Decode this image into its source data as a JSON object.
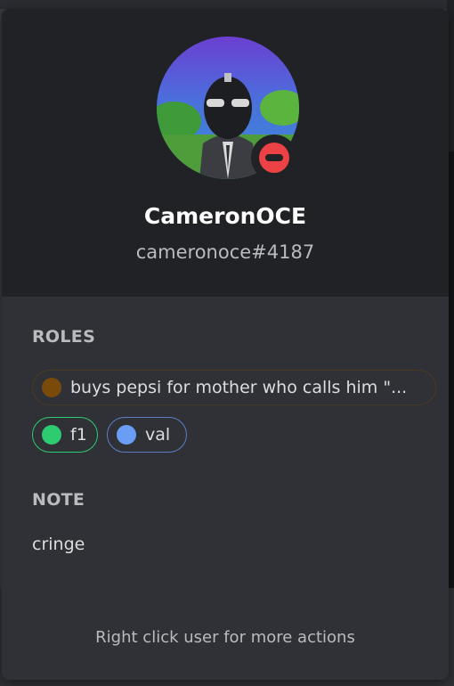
{
  "profile": {
    "display_name": "CameronOCE",
    "username": "cameronoce#4187",
    "status": "do-not-disturb",
    "status_color": "#ed4245"
  },
  "roles": {
    "title": "ROLES",
    "items": [
      {
        "label": "buys pepsi for mother who calls him \"...",
        "color": "#7a4a0b"
      },
      {
        "label": "f1",
        "color": "#2ecc71"
      },
      {
        "label": "val",
        "color": "#6a9ef5"
      }
    ]
  },
  "note": {
    "title": "NOTE",
    "value": "cringe"
  },
  "footer": {
    "hint": "Right click user for more actions"
  },
  "colors": {
    "popout_bg": "#2f3136",
    "header_bg": "#202225",
    "text_primary": "#ffffff",
    "text_muted": "#b9bbbe"
  }
}
